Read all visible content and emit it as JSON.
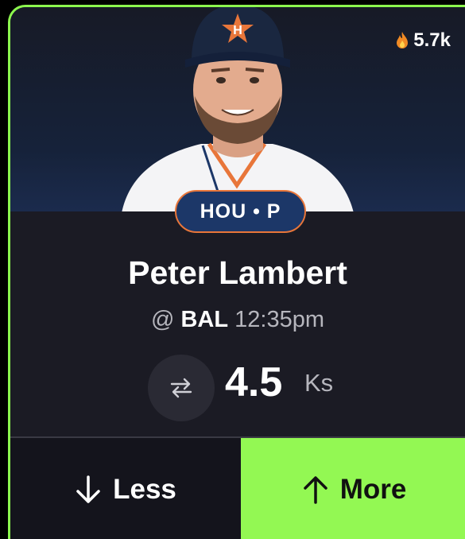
{
  "popularity": {
    "count": "5.7k",
    "icon": "fire-icon"
  },
  "player": {
    "team_position": "HOU • P",
    "name": "Peter Lambert",
    "matchup_prefix": "@",
    "opponent": "BAL",
    "game_time": "12:35pm"
  },
  "projection": {
    "line": "4.5",
    "stat": "Ks",
    "icon": "swap-arrows-icon"
  },
  "actions": {
    "less": {
      "label": "Less",
      "icon": "arrow-down-icon"
    },
    "more": {
      "label": "More",
      "icon": "arrow-up-icon"
    }
  },
  "colors": {
    "accent_green": "#93f853",
    "team_navy": "#1c3768",
    "team_orange": "#e8763a",
    "card_bg": "#1b1b24"
  }
}
